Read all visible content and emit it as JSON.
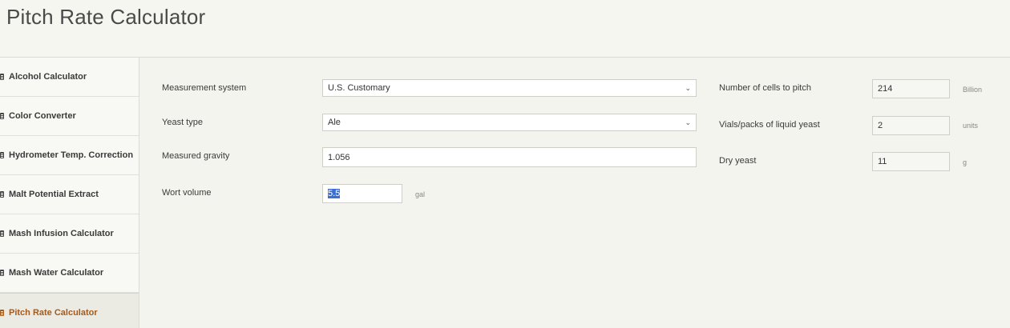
{
  "header": {
    "title": "Pitch Rate Calculator"
  },
  "sidebar": {
    "items": [
      {
        "label": "Alcohol Calculator",
        "icon": "calculator-icon"
      },
      {
        "label": "Color Converter",
        "icon": "calculator-icon"
      },
      {
        "label": "Hydrometer Temp. Correction",
        "icon": "calculator-icon"
      },
      {
        "label": "Malt Potential Extract",
        "icon": "calculator-icon"
      },
      {
        "label": "Mash Infusion Calculator",
        "icon": "calculator-icon"
      },
      {
        "label": "Mash Water Calculator",
        "icon": "calculator-icon"
      },
      {
        "label": "Pitch Rate Calculator",
        "icon": "calculator-icon",
        "active": true
      }
    ]
  },
  "form": {
    "measurement_system": {
      "label": "Measurement system",
      "value": "U.S. Customary"
    },
    "yeast_type": {
      "label": "Yeast type",
      "value": "Ale"
    },
    "measured_gravity": {
      "label": "Measured gravity",
      "value": "1.056"
    },
    "wort_volume": {
      "label": "Wort volume",
      "value": "5.5",
      "unit": "gal"
    }
  },
  "results": {
    "cells": {
      "label": "Number of cells to pitch",
      "value": "214",
      "unit": "Billion"
    },
    "vials": {
      "label": "Vials/packs of liquid yeast",
      "value": "2",
      "unit": "units"
    },
    "dry": {
      "label": "Dry yeast",
      "value": "11",
      "unit": "g"
    }
  },
  "colors": {
    "accent": "#a35a1c",
    "selection": "#3b6fd6"
  }
}
